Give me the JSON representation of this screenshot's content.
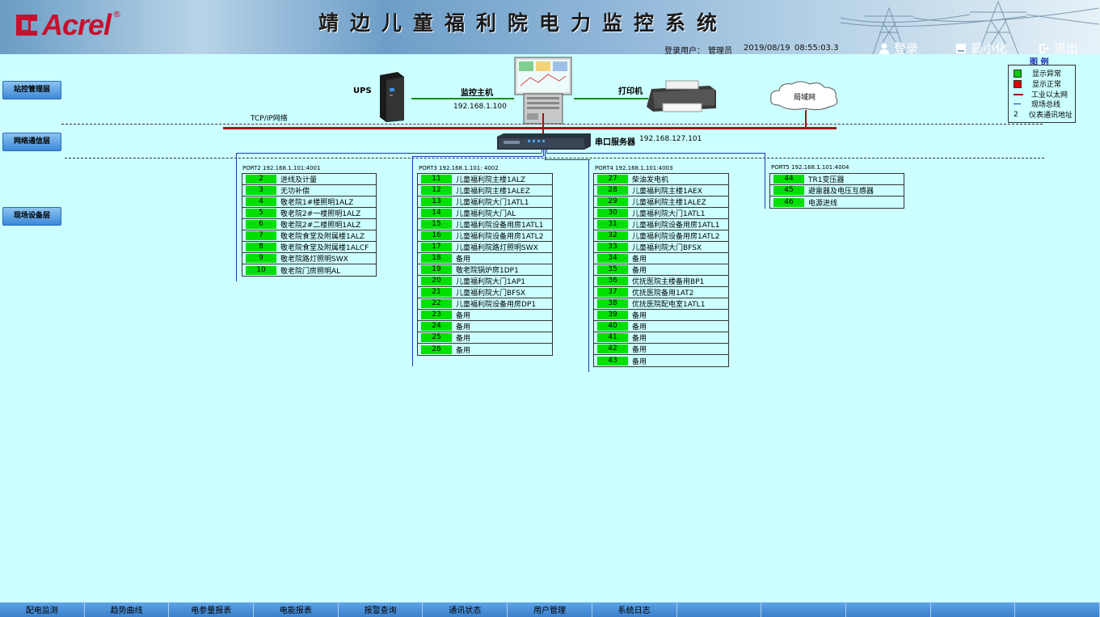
{
  "header": {
    "brand": "Acrel",
    "brand_mark": "®",
    "title": "靖边儿童福利院电力监控系统",
    "login_user_label": "登录用户：",
    "login_user": "管理员",
    "date": "2019/08/19",
    "time": "08:55:03.3",
    "buttons": {
      "login": "登录",
      "minimize": "最小化",
      "exit": "退出"
    }
  },
  "layers": {
    "station": "站控管理层",
    "network": "网络通信层",
    "field": "现场设备层"
  },
  "topology": {
    "ups_label": "UPS",
    "host_label": "监控主机",
    "host_ip": "192.168.1.100",
    "printer_label": "打印机",
    "lan_label": "局域网",
    "tcp_label": "TCP/IP网络",
    "serial_server_label": "串口服务器",
    "serial_server_ip": "192.168.127.101"
  },
  "ports": [
    {
      "label": "PORT2  192.168.1.101:4001",
      "devices": [
        {
          "addr": "2",
          "name": "进线及计量"
        },
        {
          "addr": "3",
          "name": "无功补偿"
        },
        {
          "addr": "4",
          "name": "敬老院1#楼照明1ALZ"
        },
        {
          "addr": "5",
          "name": "敬老院2#一楼照明1ALZ"
        },
        {
          "addr": "6",
          "name": "敬老院2#二楼照明1ALZ"
        },
        {
          "addr": "7",
          "name": "敬老院食堂及附属楼1ALZ"
        },
        {
          "addr": "8",
          "name": "敬老院食堂及附属楼1ALCF"
        },
        {
          "addr": "9",
          "name": "敬老院路灯照明SWX"
        },
        {
          "addr": "10",
          "name": "敬老院门房照明AL"
        }
      ]
    },
    {
      "label": "PORT3  192.168.1.101:  4002",
      "devices": [
        {
          "addr": "11",
          "name": "儿童福利院主楼1ALZ"
        },
        {
          "addr": "12",
          "name": "儿童福利院主楼1ALEZ"
        },
        {
          "addr": "13",
          "name": "儿童福利院大门1ATL1"
        },
        {
          "addr": "14",
          "name": "儿童福利院大门AL"
        },
        {
          "addr": "15",
          "name": "儿童福利院设备用房1ATL1"
        },
        {
          "addr": "16",
          "name": "儿童福利院设备用房1ATL2"
        },
        {
          "addr": "17",
          "name": "儿童福利院路灯照明SWX"
        },
        {
          "addr": "18",
          "name": "备用"
        },
        {
          "addr": "19",
          "name": "敬老院锅炉房1DP1"
        },
        {
          "addr": "20",
          "name": "儿童福利院大门1AP1"
        },
        {
          "addr": "21",
          "name": "儿童福利院大门BFSX"
        },
        {
          "addr": "22",
          "name": "儿童福利院设备用房DP1"
        },
        {
          "addr": "23",
          "name": "备用"
        },
        {
          "addr": "24",
          "name": "备用"
        },
        {
          "addr": "25",
          "name": "备用"
        },
        {
          "addr": "26",
          "name": "备用"
        }
      ]
    },
    {
      "label": "PORT4  192.168.1.101:4003",
      "devices": [
        {
          "addr": "27",
          "name": "柴油发电机"
        },
        {
          "addr": "28",
          "name": "儿童福利院主楼1AEX"
        },
        {
          "addr": "29",
          "name": "儿童福利院主楼1ALEZ"
        },
        {
          "addr": "30",
          "name": "儿童福利院大门1ATL1"
        },
        {
          "addr": "31",
          "name": "儿童福利院设备用房1ATL1"
        },
        {
          "addr": "32",
          "name": "儿童福利院设备用房1ATL2"
        },
        {
          "addr": "33",
          "name": "儿童福利院大门BFSX"
        },
        {
          "addr": "34",
          "name": "备用"
        },
        {
          "addr": "35",
          "name": "备用"
        },
        {
          "addr": "36",
          "name": "优抚医院主楼备用BP1"
        },
        {
          "addr": "37",
          "name": "优抚医院备用1AT2"
        },
        {
          "addr": "38",
          "name": "优抚医院配电室1ATL1"
        },
        {
          "addr": "39",
          "name": "备用"
        },
        {
          "addr": "40",
          "name": "备用"
        },
        {
          "addr": "41",
          "name": "备用"
        },
        {
          "addr": "42",
          "name": "备用"
        },
        {
          "addr": "43",
          "name": "备用"
        }
      ]
    },
    {
      "label": "PORT5  192.168.1.101:4004",
      "devices": [
        {
          "addr": "44",
          "name": "TR1变压器"
        },
        {
          "addr": "45",
          "name": "避雷器及电压互感器"
        },
        {
          "addr": "46",
          "name": "电源进线"
        }
      ]
    }
  ],
  "legend": {
    "title": "图 例",
    "abnormal": "显示异常",
    "normal": "显示正常",
    "ethernet": "工业以太网",
    "fieldbus": "现场总线",
    "addr_sample": "2",
    "addr_desc": "仪表通讯地址",
    "abnormal_color": "#00cc00",
    "normal_color": "#dd0000"
  },
  "tabs": [
    "配电监测",
    "趋势曲线",
    "电参量报表",
    "电能报表",
    "报警查询",
    "通讯状态",
    "用户管理",
    "系统日志",
    "",
    "",
    "",
    "",
    ""
  ]
}
